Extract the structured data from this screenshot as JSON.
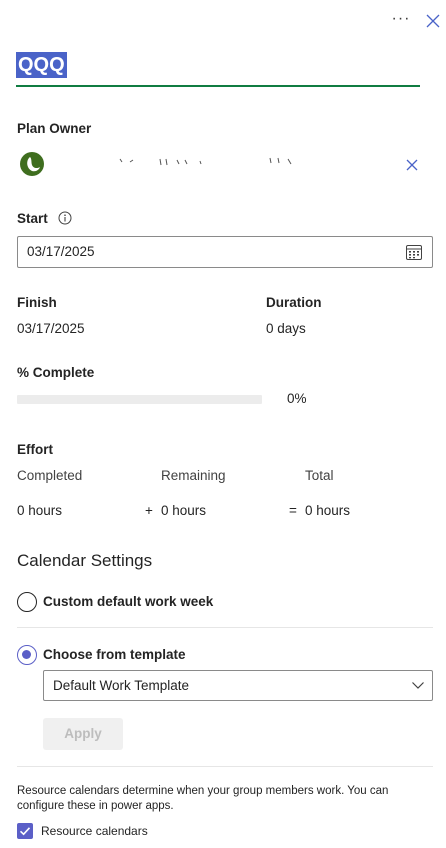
{
  "header": {
    "more_icon": "more-horizontal-icon",
    "more_glyph": "···",
    "close_icon": "close-icon"
  },
  "title": "QQQ",
  "plan_owner": {
    "label": "Plan Owner",
    "avatar_color": "#3f6e1f",
    "remove_icon": "close-icon"
  },
  "start": {
    "label": "Start",
    "info_icon": "info-icon",
    "value": "03/17/2025",
    "calendar_icon": "calendar-icon"
  },
  "finish": {
    "label": "Finish",
    "value": "03/17/2025"
  },
  "duration": {
    "label": "Duration",
    "value": "0 days"
  },
  "complete": {
    "label": "% Complete",
    "value": "0%",
    "fraction": 0
  },
  "effort": {
    "label": "Effort",
    "completed_label": "Completed",
    "remaining_label": "Remaining",
    "total_label": "Total",
    "completed_value": "0 hours",
    "plus": "+",
    "remaining_value": "0 hours",
    "equals": "=",
    "total_value": "0 hours"
  },
  "calendar_settings": {
    "title": "Calendar Settings",
    "option_custom": "Custom default work week",
    "option_template": "Choose from template",
    "selected": "template",
    "template_value": "Default Work Template",
    "chevron_icon": "chevron-down-icon",
    "apply_label": "Apply"
  },
  "resource": {
    "note": "Resource calendars determine when your group members work. You can configure these in power apps.",
    "checkbox_label": "Resource calendars",
    "checked": true
  },
  "colors": {
    "accent": "#5b5fc7",
    "title_highlight": "#4a63c8",
    "title_underline": "#107c41"
  }
}
